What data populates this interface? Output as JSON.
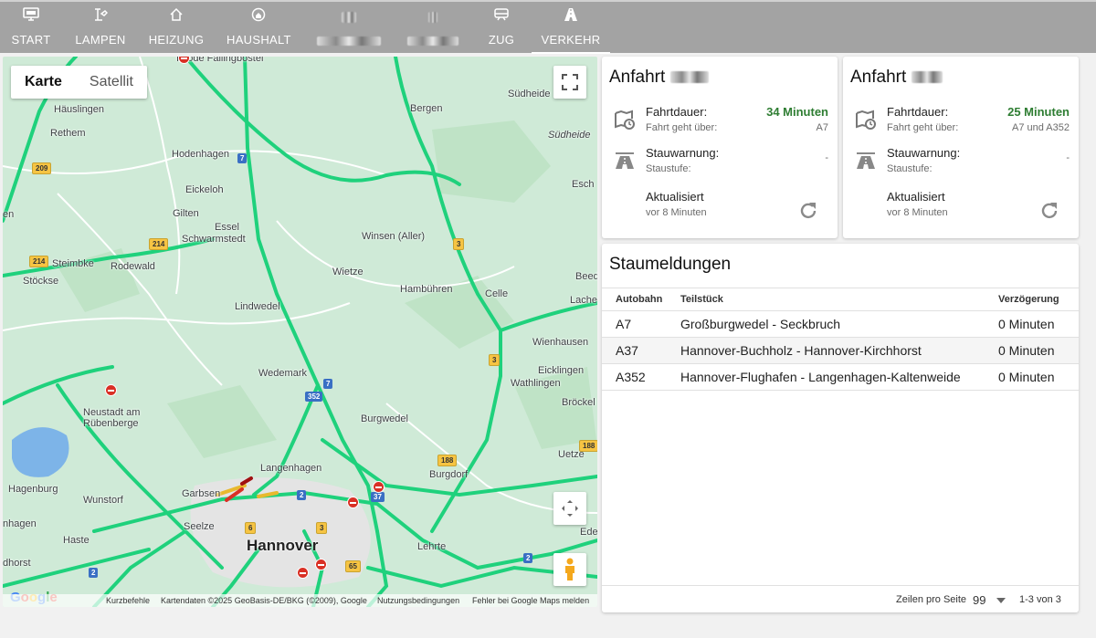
{
  "nav": {
    "tabs": [
      {
        "label": "START",
        "icon": "monitor-icon"
      },
      {
        "label": "LAMPEN",
        "icon": "lamp-icon"
      },
      {
        "label": "HEIZUNG",
        "icon": "house-outline-icon"
      },
      {
        "label": "HAUSHALT",
        "icon": "home-circle-icon"
      },
      {
        "label": "",
        "icon": "blurred-icon"
      },
      {
        "label": "",
        "icon": "blurred-icon"
      },
      {
        "label": "ZUG",
        "icon": "train-icon"
      },
      {
        "label": "VERKEHR",
        "icon": "road-icon",
        "active": true
      }
    ]
  },
  "map": {
    "type_karte": "Karte",
    "type_satellit": "Satellit",
    "labels": {
      "huslingen": "Häuslingen",
      "rethem": "Rethem",
      "hodenhagen": "Hodenhagen",
      "eickeloh": "Eickeloh",
      "gilten": "Gilten",
      "essel": "Essel",
      "schwarmstedt": "Schwarmstedt",
      "steimbke": "Steimbke",
      "rodewald": "Rodewald",
      "stockse": "Stöckse",
      "lindwedel": "Lindwedel",
      "wedemark": "Wedemark",
      "neustadt": "Neustadt am",
      "rubenberge": "Rübenberge",
      "hagenburg": "Hagenburg",
      "wunstorf": "Wunstorf",
      "garbsen": "Garbsen",
      "seelze": "Seelze",
      "langenhagen": "Langenhagen",
      "hannover": "Hannover",
      "haste": "Haste",
      "lehrte": "Lehrte",
      "burgdorf": "Burgdorf",
      "burgwedel": "Burgwedel",
      "wietze": "Wietze",
      "winsen": "Winsen (Aller)",
      "hambuhren": "Hambühren",
      "celle": "Celle",
      "bergen": "Bergen",
      "sudheide": "Südheide",
      "sudheide2": "Südheide",
      "esch": "Esch",
      "beed": "Beed",
      "lache": "Lache",
      "wienhausen": "Wienhausen",
      "eicklingen": "Eicklingen",
      "wathlingen": "Wathlingen",
      "brockel": "Bröckel",
      "uetze": "Uetze",
      "ede": "Ede",
      "horst": "dhorst",
      "nhagen": "nhagen",
      "en": "en",
      "top": "Isrode  Fallingbostel"
    },
    "shields": {
      "s7a": "7",
      "s7b": "7",
      "s352": "352",
      "s2a": "2",
      "s2b": "2",
      "s2c": "2",
      "s37": "37",
      "s209": "209",
      "s214a": "214",
      "s214b": "214",
      "s3a": "3",
      "s3b": "3",
      "s3c": "3",
      "s188a": "188",
      "s188b": "188",
      "s6": "6",
      "s65": "65"
    },
    "footer": {
      "shortcuts": "Kurzbefehle",
      "attribution": "Kartendaten ©2025 GeoBasis-DE/BKG (©2009), Google",
      "terms": "Nutzungsbedingungen",
      "report": "Fehler bei Google Maps melden"
    },
    "logo": "Google"
  },
  "cards": [
    {
      "title": "Anfahrt",
      "duration_label": "Fahrtdauer:",
      "duration_value": "34 Minuten",
      "route_label": "Fahrt geht über:",
      "route_value": "A7",
      "jam_label": "Stauwarnung:",
      "jam_level_label": "Staustufe:",
      "jam_value": "-",
      "updated_label": "Aktualisiert",
      "updated_value": "vor 8 Minuten"
    },
    {
      "title": "Anfahrt",
      "duration_label": "Fahrtdauer:",
      "duration_value": "25 Minuten",
      "route_label": "Fahrt geht über:",
      "route_value": "A7 und A352",
      "jam_label": "Stauwarnung:",
      "jam_level_label": "Staustufe:",
      "jam_value": "-",
      "updated_label": "Aktualisiert",
      "updated_value": "vor 8 Minuten"
    }
  ],
  "jams": {
    "title": "Staumeldungen",
    "headers": {
      "road": "Autobahn",
      "segment": "Teilstück",
      "delay": "Verzögerung"
    },
    "rows": [
      {
        "road": "A7",
        "segment": "Großburgwedel - Seckbruch",
        "delay": "0 Minuten"
      },
      {
        "road": "A37",
        "segment": "Hannover-Buchholz - Hannover-Kirchhorst",
        "delay": "0 Minuten"
      },
      {
        "road": "A352",
        "segment": "Hannover-Flughafen - Langenhagen-Kaltenweide",
        "delay": "0 Minuten"
      }
    ],
    "footer": {
      "rows_per_page_label": "Zeilen pro Seite",
      "rows_per_page": "99",
      "range": "1-3 von 3"
    }
  },
  "colors": {
    "nav_bg": "#a3a3a3",
    "accent_green": "#2e7d32",
    "road_green": "#1fd17c",
    "map_bg": "#cfead7"
  }
}
